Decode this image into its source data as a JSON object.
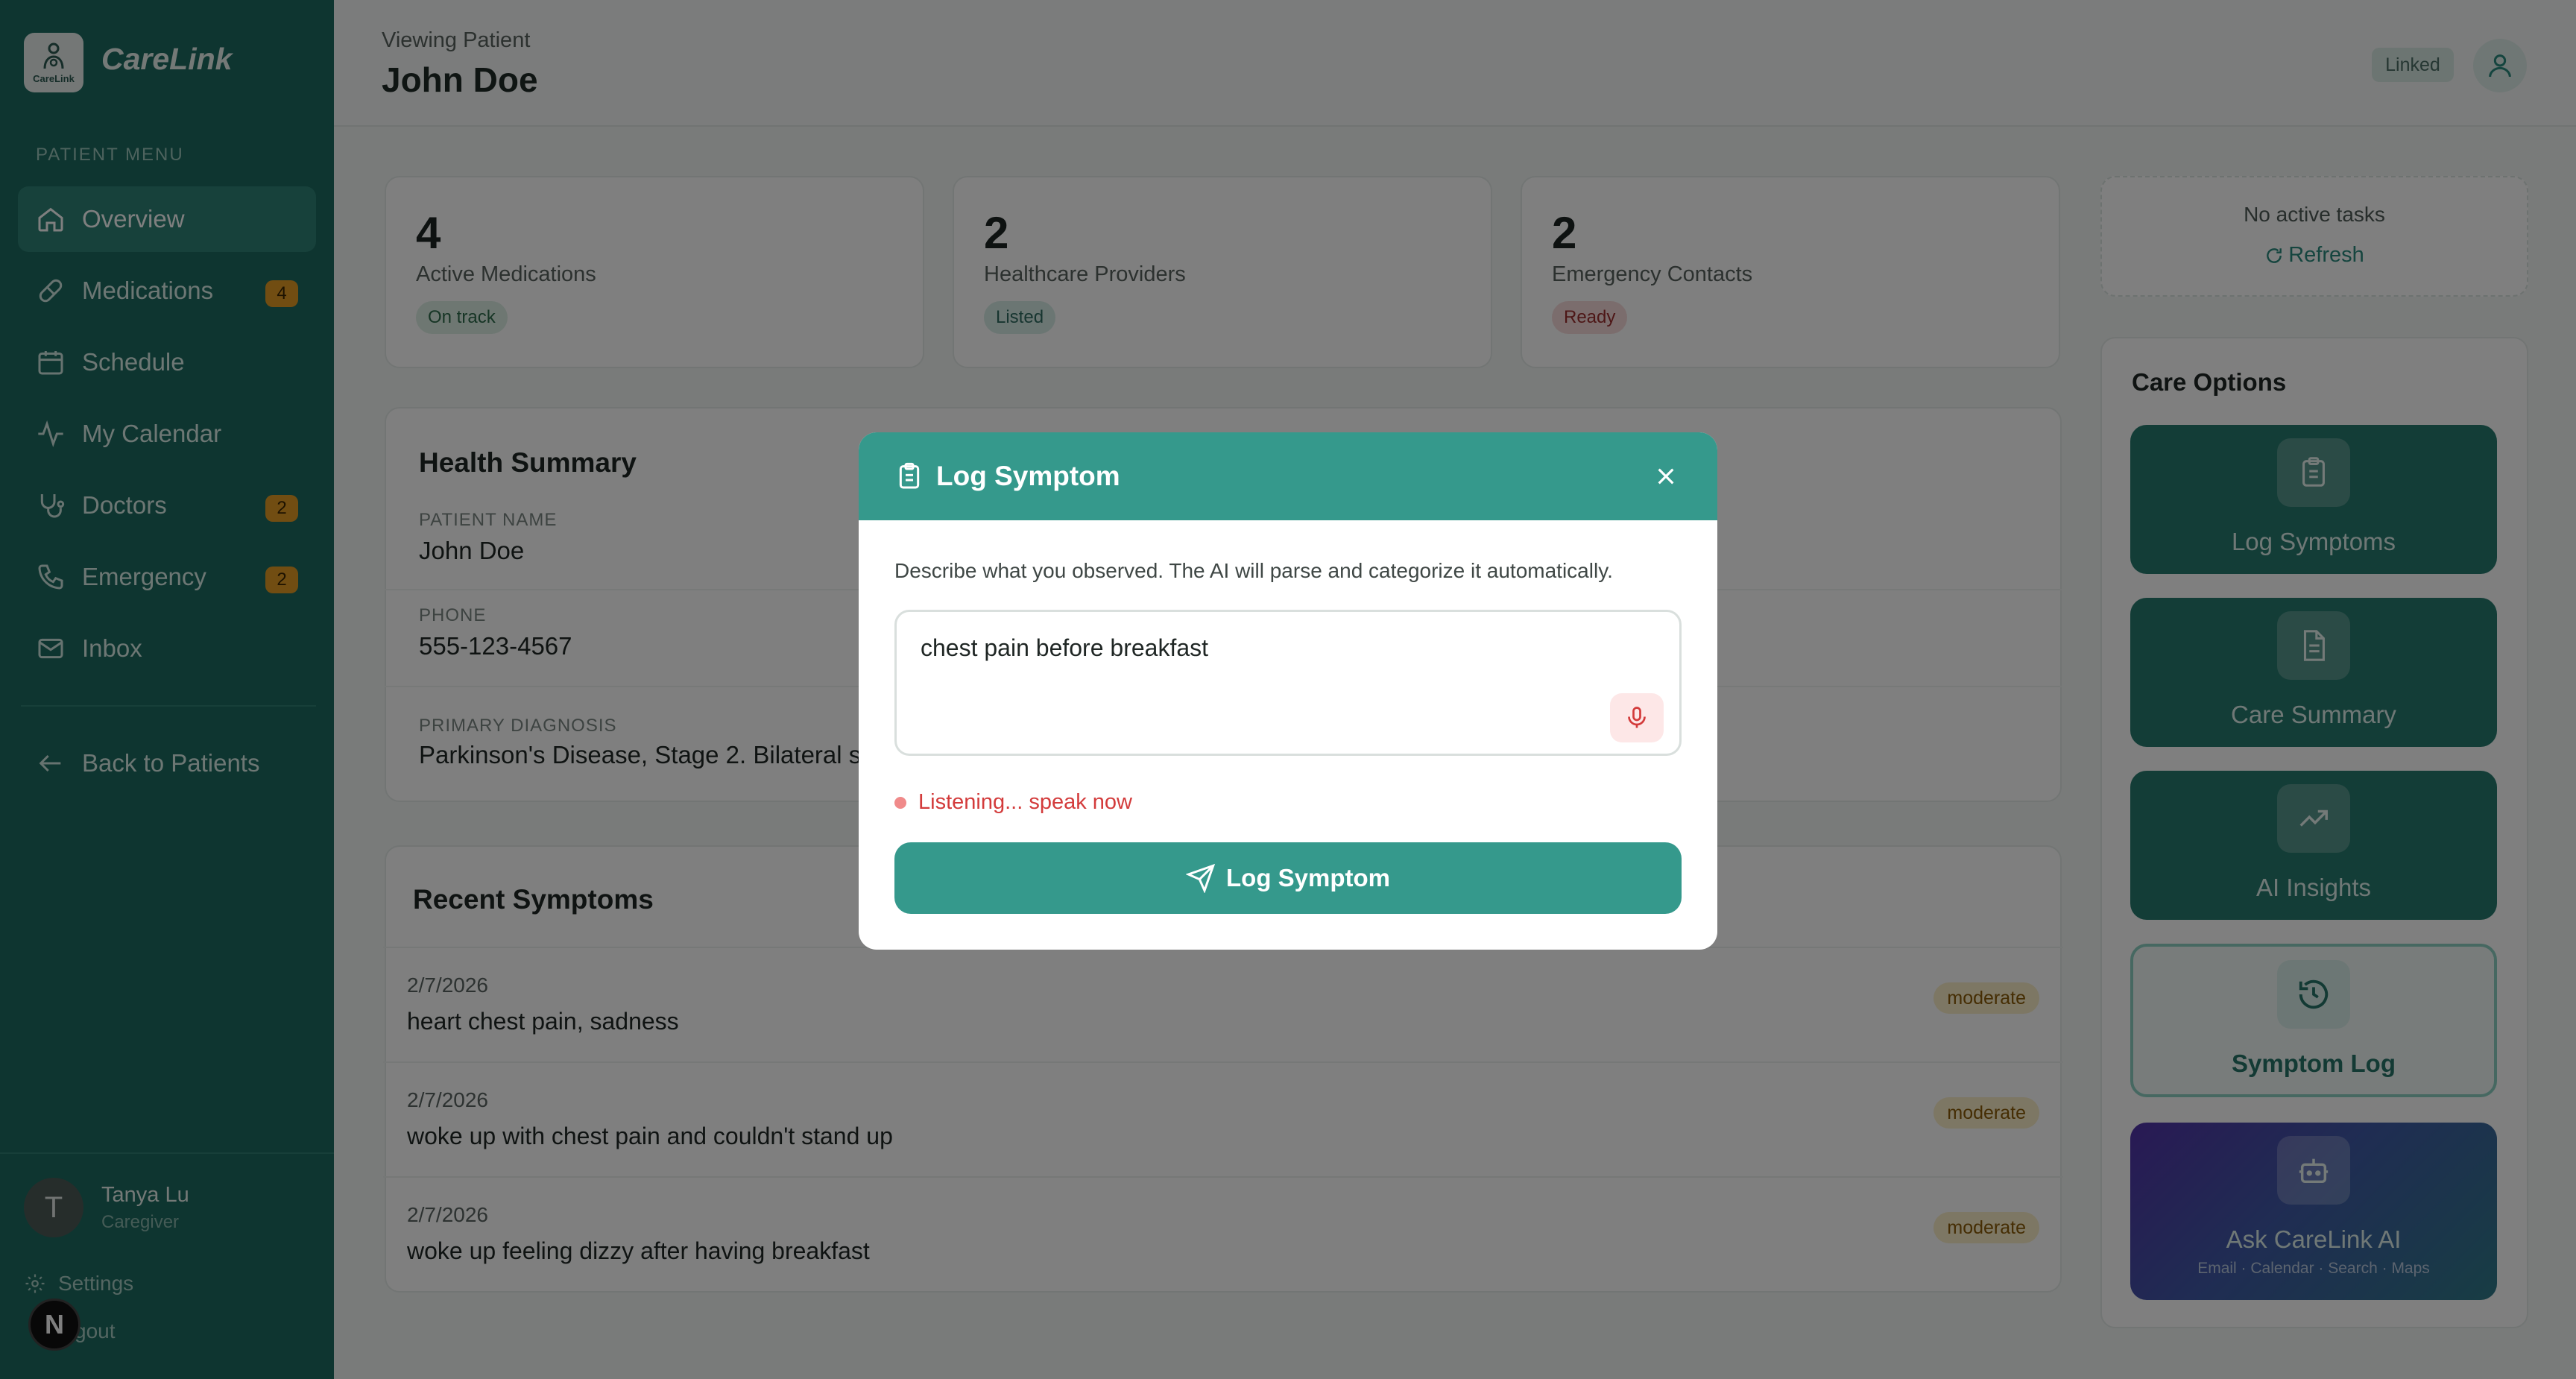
{
  "app": {
    "brand": "CareLink",
    "logo_text": "CareLink"
  },
  "sidebar": {
    "section_label": "PATIENT MENU",
    "items": [
      {
        "label": "Overview",
        "icon": "home-icon",
        "badge": ""
      },
      {
        "label": "Medications",
        "icon": "pill-icon",
        "badge": "4"
      },
      {
        "label": "Schedule",
        "icon": "calendar-icon",
        "badge": ""
      },
      {
        "label": "My Calendar",
        "icon": "activity-icon",
        "badge": ""
      },
      {
        "label": "Doctors",
        "icon": "stethoscope-icon",
        "badge": "2"
      },
      {
        "label": "Emergency",
        "icon": "phone-icon",
        "badge": "2"
      },
      {
        "label": "Inbox",
        "icon": "mail-icon",
        "badge": ""
      }
    ],
    "back_label": "Back to Patients",
    "user": {
      "initial": "T",
      "name": "Tanya Lu",
      "role": "Caregiver"
    },
    "settings_label": "Settings",
    "logout_label": "gout",
    "n_badge": "N"
  },
  "header": {
    "viewing_label": "Viewing Patient",
    "patient_name": "John Doe",
    "link_status": "Linked"
  },
  "stats": [
    {
      "value": "4",
      "label": "Active Medications",
      "status": "On track"
    },
    {
      "value": "2",
      "label": "Healthcare Providers",
      "status": "Listed"
    },
    {
      "value": "2",
      "label": "Emergency Contacts",
      "status": "Ready"
    }
  ],
  "health_summary": {
    "title": "Health Summary",
    "patient_name_label": "PATIENT NAME",
    "patient_name": "John Doe",
    "phone_label": "PHONE",
    "phone": "555-123-4567",
    "diagnosis_label": "PRIMARY DIAGNOSIS",
    "diagnosis": "Parkinson's Disease, Stage 2. Bilateral s"
  },
  "recent_symptoms": {
    "title": "Recent Symptoms",
    "items": [
      {
        "date": "2/7/2026",
        "text": "heart chest pain, sadness",
        "severity": "moderate"
      },
      {
        "date": "2/7/2026",
        "text": "woke up with chest pain and couldn't stand up",
        "severity": "moderate"
      },
      {
        "date": "2/7/2026",
        "text": "woke up feeling dizzy after having breakfast",
        "severity": "moderate"
      }
    ]
  },
  "tasks": {
    "empty_text": "No active tasks",
    "refresh_label": "Refresh"
  },
  "care_options": {
    "title": "Care Options",
    "items": [
      {
        "label": "Log Symptoms",
        "icon": "clipboard-icon"
      },
      {
        "label": "Care Summary",
        "icon": "document-icon"
      },
      {
        "label": "AI Insights",
        "icon": "trending-up-icon"
      },
      {
        "label": "Symptom Log",
        "icon": "history-icon"
      },
      {
        "label": "Ask CareLink AI",
        "icon": "robot-icon",
        "sub": "Email · Calendar · Search · Maps"
      }
    ]
  },
  "modal": {
    "title": "Log Symptom",
    "description": "Describe what you observed. The AI will parse and categorize it automatically.",
    "input_value": "chest pain before breakfast",
    "listening_text": "Listening... speak now",
    "submit_label": "Log Symptom"
  },
  "colors": {
    "primary": "#35998c",
    "sidebar": "#1d6b60",
    "badge": "#e39a25",
    "danger": "#d33b3b"
  }
}
